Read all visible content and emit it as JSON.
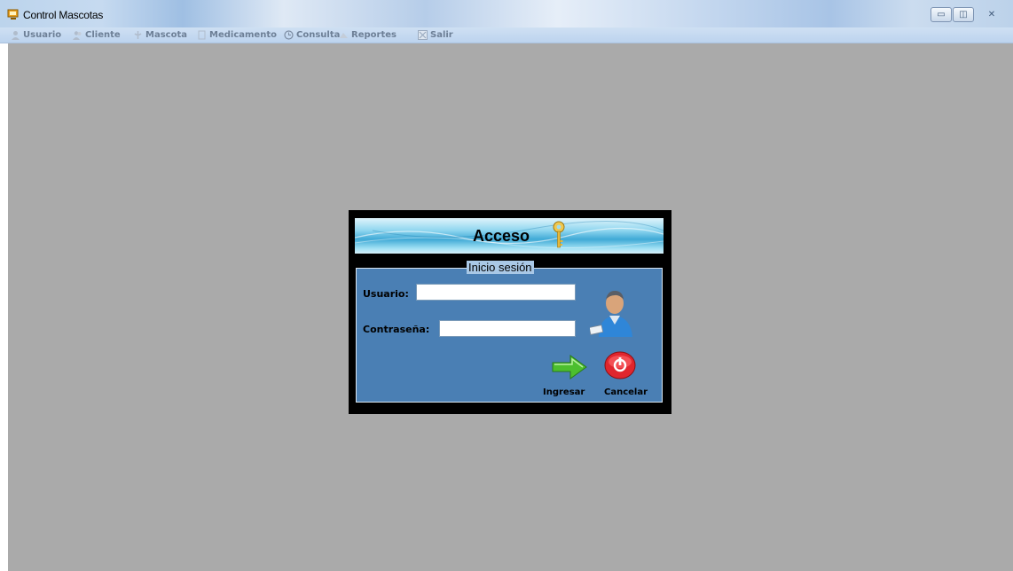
{
  "window": {
    "title": "Control Mascotas",
    "buttons": {
      "minimize": "▭",
      "restore": "◫",
      "close": "✕"
    }
  },
  "menu": {
    "items": [
      {
        "label": "Usuario",
        "icon": "user-icon"
      },
      {
        "label": "Cliente",
        "icon": "clients-icon"
      },
      {
        "label": "Mascota",
        "icon": "pet-icon"
      },
      {
        "label": "Medicamento",
        "icon": "medicine-icon"
      },
      {
        "label": "Consulta",
        "icon": "clock-icon"
      },
      {
        "label": "Reportes",
        "icon": "reports-icon"
      },
      {
        "label": "Salir",
        "icon": "exit-icon"
      }
    ]
  },
  "login": {
    "banner_title": "Acceso",
    "group_title": "Inicio sesión",
    "user_label": "Usuario:",
    "user_value": "",
    "password_label": "Contraseña:",
    "password_value": "",
    "enter_label": "Ingresar",
    "cancel_label": "Cancelar"
  },
  "colors": {
    "workspace": "#aaaaaa",
    "panel": "#4a7fb4",
    "menu_text": "#6d7f96"
  }
}
